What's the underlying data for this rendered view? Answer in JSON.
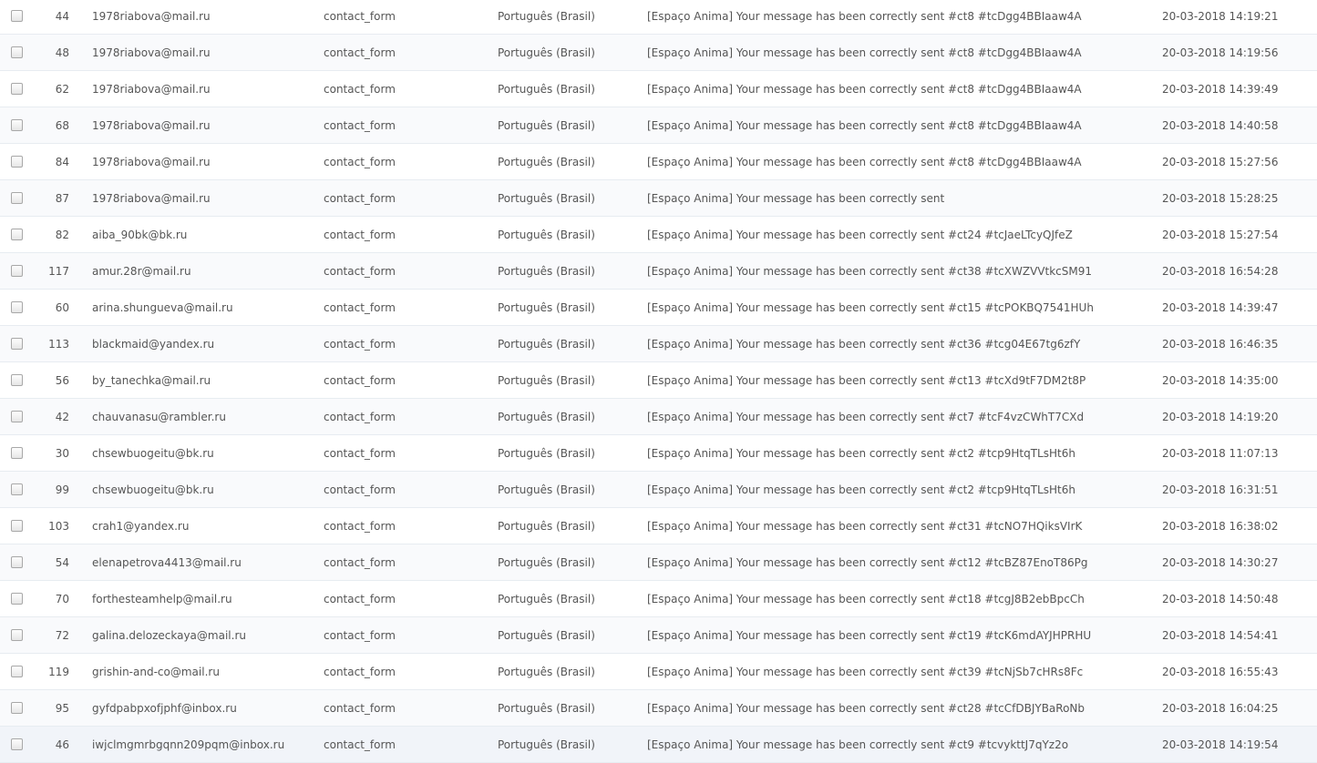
{
  "table": {
    "rows": [
      {
        "id": "44",
        "email": "1978riabova@mail.ru",
        "form": "contact_form",
        "language": "Português (Brasil)",
        "subject": "[Espaço Anima] Your message has been correctly sent #ct8 #tcDgg4BBIaaw4A",
        "date": "20-03-2018 14:19:21"
      },
      {
        "id": "48",
        "email": "1978riabova@mail.ru",
        "form": "contact_form",
        "language": "Português (Brasil)",
        "subject": "[Espaço Anima] Your message has been correctly sent #ct8 #tcDgg4BBIaaw4A",
        "date": "20-03-2018 14:19:56"
      },
      {
        "id": "62",
        "email": "1978riabova@mail.ru",
        "form": "contact_form",
        "language": "Português (Brasil)",
        "subject": "[Espaço Anima] Your message has been correctly sent #ct8 #tcDgg4BBIaaw4A",
        "date": "20-03-2018 14:39:49"
      },
      {
        "id": "68",
        "email": "1978riabova@mail.ru",
        "form": "contact_form",
        "language": "Português (Brasil)",
        "subject": "[Espaço Anima] Your message has been correctly sent #ct8 #tcDgg4BBIaaw4A",
        "date": "20-03-2018 14:40:58"
      },
      {
        "id": "84",
        "email": "1978riabova@mail.ru",
        "form": "contact_form",
        "language": "Português (Brasil)",
        "subject": "[Espaço Anima] Your message has been correctly sent #ct8 #tcDgg4BBIaaw4A",
        "date": "20-03-2018 15:27:56"
      },
      {
        "id": "87",
        "email": "1978riabova@mail.ru",
        "form": "contact_form",
        "language": "Português (Brasil)",
        "subject": "[Espaço Anima] Your message has been correctly sent",
        "date": "20-03-2018 15:28:25"
      },
      {
        "id": "82",
        "email": "aiba_90bk@bk.ru",
        "form": "contact_form",
        "language": "Português (Brasil)",
        "subject": "[Espaço Anima] Your message has been correctly sent #ct24 #tcJaeLTcyQJfeZ",
        "date": "20-03-2018 15:27:54"
      },
      {
        "id": "117",
        "email": "amur.28r@mail.ru",
        "form": "contact_form",
        "language": "Português (Brasil)",
        "subject": "[Espaço Anima] Your message has been correctly sent #ct38 #tcXWZVVtkcSM91",
        "date": "20-03-2018 16:54:28"
      },
      {
        "id": "60",
        "email": "arina.shungueva@mail.ru",
        "form": "contact_form",
        "language": "Português (Brasil)",
        "subject": "[Espaço Anima] Your message has been correctly sent #ct15 #tcPOKBQ7541HUh",
        "date": "20-03-2018 14:39:47"
      },
      {
        "id": "113",
        "email": "blackmaid@yandex.ru",
        "form": "contact_form",
        "language": "Português (Brasil)",
        "subject": "[Espaço Anima] Your message has been correctly sent #ct36 #tcg04E67tg6zfY",
        "date": "20-03-2018 16:46:35"
      },
      {
        "id": "56",
        "email": "by_tanechka@mail.ru",
        "form": "contact_form",
        "language": "Português (Brasil)",
        "subject": "[Espaço Anima] Your message has been correctly sent #ct13 #tcXd9tF7DM2t8P",
        "date": "20-03-2018 14:35:00"
      },
      {
        "id": "42",
        "email": "chauvanasu@rambler.ru",
        "form": "contact_form",
        "language": "Português (Brasil)",
        "subject": "[Espaço Anima] Your message has been correctly sent #ct7 #tcF4vzCWhT7CXd",
        "date": "20-03-2018 14:19:20"
      },
      {
        "id": "30",
        "email": "chsewbuogeitu@bk.ru",
        "form": "contact_form",
        "language": "Português (Brasil)",
        "subject": "[Espaço Anima] Your message has been correctly sent #ct2 #tcp9HtqTLsHt6h",
        "date": "20-03-2018 11:07:13"
      },
      {
        "id": "99",
        "email": "chsewbuogeitu@bk.ru",
        "form": "contact_form",
        "language": "Português (Brasil)",
        "subject": "[Espaço Anima] Your message has been correctly sent #ct2 #tcp9HtqTLsHt6h",
        "date": "20-03-2018 16:31:51"
      },
      {
        "id": "103",
        "email": "crah1@yandex.ru",
        "form": "contact_form",
        "language": "Português (Brasil)",
        "subject": "[Espaço Anima] Your message has been correctly sent #ct31 #tcNO7HQiksVIrK",
        "date": "20-03-2018 16:38:02"
      },
      {
        "id": "54",
        "email": "elenapetrova4413@mail.ru",
        "form": "contact_form",
        "language": "Português (Brasil)",
        "subject": "[Espaço Anima] Your message has been correctly sent #ct12 #tcBZ87EnoT86Pg",
        "date": "20-03-2018 14:30:27"
      },
      {
        "id": "70",
        "email": "forthesteamhelp@mail.ru",
        "form": "contact_form",
        "language": "Português (Brasil)",
        "subject": "[Espaço Anima] Your message has been correctly sent #ct18 #tcgJ8B2ebBpcCh",
        "date": "20-03-2018 14:50:48"
      },
      {
        "id": "72",
        "email": "galina.delozeckaya@mail.ru",
        "form": "contact_form",
        "language": "Português (Brasil)",
        "subject": "[Espaço Anima] Your message has been correctly sent #ct19 #tcK6mdAYJHPRHU",
        "date": "20-03-2018 14:54:41"
      },
      {
        "id": "119",
        "email": "grishin-and-co@mail.ru",
        "form": "contact_form",
        "language": "Português (Brasil)",
        "subject": "[Espaço Anima] Your message has been correctly sent #ct39 #tcNjSb7cHRs8Fc",
        "date": "20-03-2018 16:55:43"
      },
      {
        "id": "95",
        "email": "gyfdpabpxofjphf@inbox.ru",
        "form": "contact_form",
        "language": "Português (Brasil)",
        "subject": "[Espaço Anima] Your message has been correctly sent #ct28 #tcCfDBJYBaRoNb",
        "date": "20-03-2018 16:04:25"
      },
      {
        "id": "46",
        "email": "iwjclmgmrbgqnn209pqm@inbox.ru",
        "form": "contact_form",
        "language": "Português (Brasil)",
        "subject": "[Espaço Anima] Your message has been correctly sent #ct9 #tcvykttJ7qYz2o",
        "date": "20-03-2018 14:19:54"
      }
    ]
  }
}
